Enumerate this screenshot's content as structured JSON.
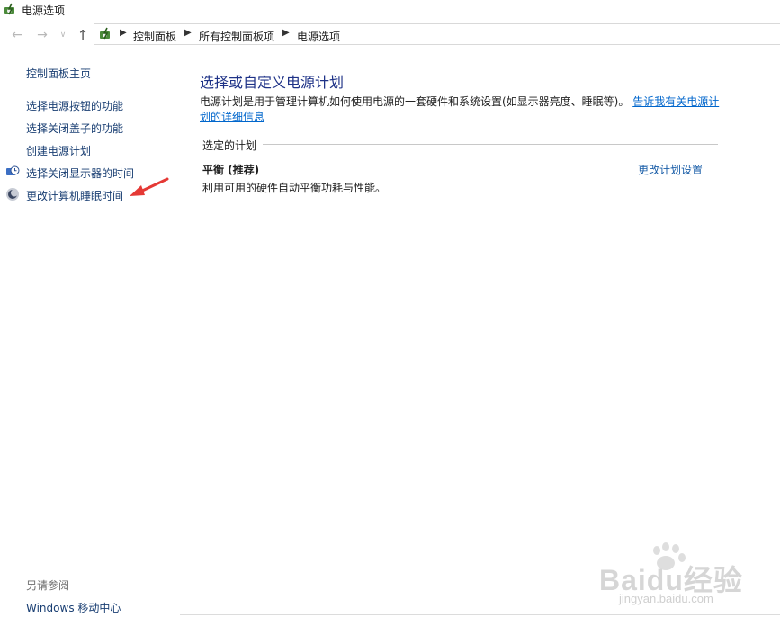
{
  "window": {
    "title": "电源选项"
  },
  "nav": {
    "back_icon": "back-arrow-icon",
    "forward_icon": "forward-arrow-icon",
    "up_icon": "up-arrow-icon",
    "breadcrumb": [
      "控制面板",
      "所有控制面板项",
      "电源选项"
    ]
  },
  "sidebar": {
    "home": "控制面板主页",
    "items": [
      {
        "label": "选择电源按钮的功能",
        "icon": ""
      },
      {
        "label": "选择关闭盖子的功能",
        "icon": ""
      },
      {
        "label": "创建电源计划",
        "icon": ""
      },
      {
        "label": "选择关闭显示器的时间",
        "icon": "clock-monitor-icon"
      },
      {
        "label": "更改计算机睡眠时间",
        "icon": "moon-sleep-icon"
      }
    ],
    "see_also_title": "另请参阅",
    "see_also": [
      "Windows 移动中心"
    ]
  },
  "main": {
    "heading": "选择或自定义电源计划",
    "description": "电源计划是用于管理计算机如何使用电源的一套硬件和系统设置(如显示器亮度、睡眠等)。",
    "learn_more": "告诉我有关电源计划的详细信息",
    "selected_plan_label": "选定的计划",
    "plan_name": "平衡 (推荐)",
    "plan_description": "利用可用的硬件自动平衡功耗与性能。",
    "change_plan_link": "更改计划设置"
  },
  "watermark": {
    "brand": "Baidu经验",
    "url": "jingyan.baidu.com"
  },
  "colors": {
    "link": "#1a3f73",
    "heading": "#1e3287",
    "hyperlink": "#0066cc",
    "annotation_arrow": "#e53935"
  }
}
